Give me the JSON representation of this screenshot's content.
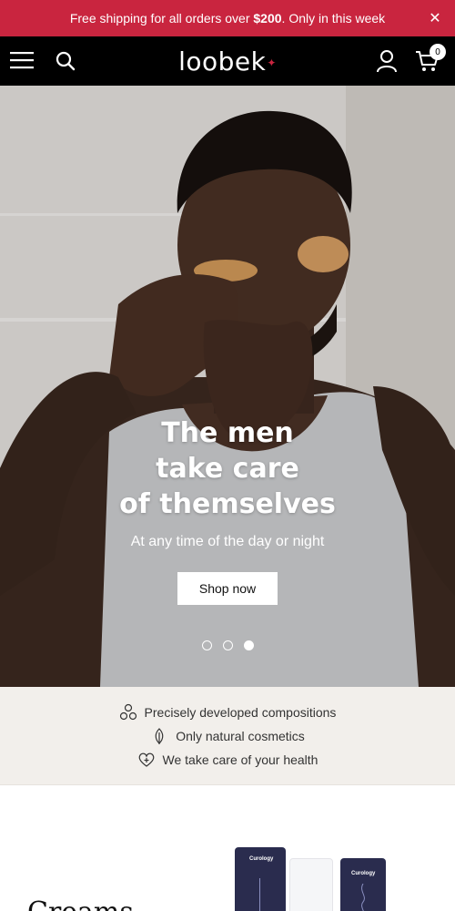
{
  "announcement": {
    "text_before": "Free shipping for all orders over ",
    "amount": "$200",
    "text_after": ". Only in this week",
    "close_icon": "close-icon"
  },
  "header": {
    "logo": "loobek",
    "logo_dot": "✦",
    "cart_count": "0",
    "icons": [
      "menu-icon",
      "search-icon",
      "account-icon",
      "cart-icon"
    ]
  },
  "hero": {
    "title_lines": [
      "The men",
      "take care",
      "of themselves"
    ],
    "subtitle": "At any time of the day or night",
    "button_label": "Shop now",
    "slides_total": 3,
    "active_slide": 3
  },
  "features": [
    {
      "icon": "molecule-icon",
      "text": "Precisely developed compositions"
    },
    {
      "icon": "leaf-icon",
      "text": "Only natural cosmetics"
    },
    {
      "icon": "heart-plus-icon",
      "text": "We take care of your health"
    }
  ],
  "preview": {
    "title": "Creams",
    "tube_brand": "Curology"
  },
  "colors": {
    "accent": "#c9253f",
    "header_bg": "#000000",
    "features_bg": "#f2efeb",
    "tube_navy": "#2a2c4e"
  }
}
